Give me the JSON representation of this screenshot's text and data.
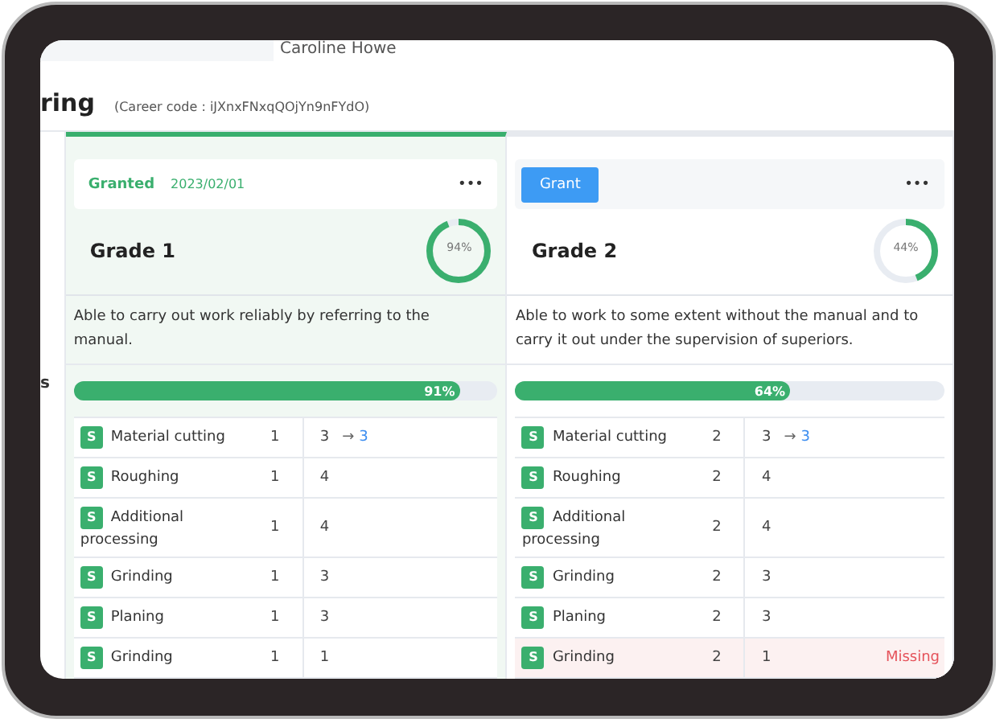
{
  "user_name": "Caroline Howe",
  "heading": "ring",
  "career_code": "(Career code : iJXnxFNxqQOjYn9nFYdO)",
  "side_label": "s",
  "grades": [
    {
      "granted": true,
      "status": "Granted",
      "date": "2023/02/01",
      "menu": "•••",
      "title": "Grade 1",
      "donut": {
        "label": "94%",
        "level": 0.94
      },
      "description": "Able to carry out work reliably by referring to the manual.",
      "level": 0.91,
      "reading": "91%",
      "skills": [
        {
          "badge": "S",
          "name": "Material cutting",
          "required": "1",
          "current": "3",
          "arrow": "→",
          "target": "3",
          "missing": false
        },
        {
          "badge": "S",
          "name": "Roughing",
          "required": "1",
          "current": "4",
          "missing": false
        },
        {
          "badge": "S",
          "name": "Additional processing",
          "required": "1",
          "current": "4",
          "missing": false
        },
        {
          "badge": "S",
          "name": "Grinding",
          "required": "1",
          "current": "3",
          "missing": false
        },
        {
          "badge": "S",
          "name": "Planing",
          "required": "1",
          "current": "3",
          "missing": false
        },
        {
          "badge": "S",
          "name": "Grinding",
          "required": "1",
          "current": "1",
          "missing": false
        }
      ]
    },
    {
      "granted": false,
      "button": "Grant",
      "menu": "•••",
      "title": "Grade 2",
      "donut": {
        "label": "44%",
        "level": 0.44
      },
      "description": "Able to work to some extent without the manual and to carry it out under the supervision of superiors.",
      "level": 0.64,
      "reading": "64%",
      "skills": [
        {
          "badge": "S",
          "name": "Material cutting",
          "required": "2",
          "current": "3",
          "arrow": "→",
          "target": "3",
          "missing": false
        },
        {
          "badge": "S",
          "name": "Roughing",
          "required": "2",
          "current": "4",
          "missing": false
        },
        {
          "badge": "S",
          "name": "Additional processing",
          "required": "2",
          "current": "4",
          "missing": false
        },
        {
          "badge": "S",
          "name": "Grinding",
          "required": "2",
          "current": "3",
          "missing": false
        },
        {
          "badge": "S",
          "name": "Planing",
          "required": "2",
          "current": "3",
          "missing": false
        },
        {
          "badge": "S",
          "name": "Grinding",
          "required": "2",
          "current": "1",
          "missing": true,
          "missing_label": "Missing"
        }
      ]
    }
  ]
}
